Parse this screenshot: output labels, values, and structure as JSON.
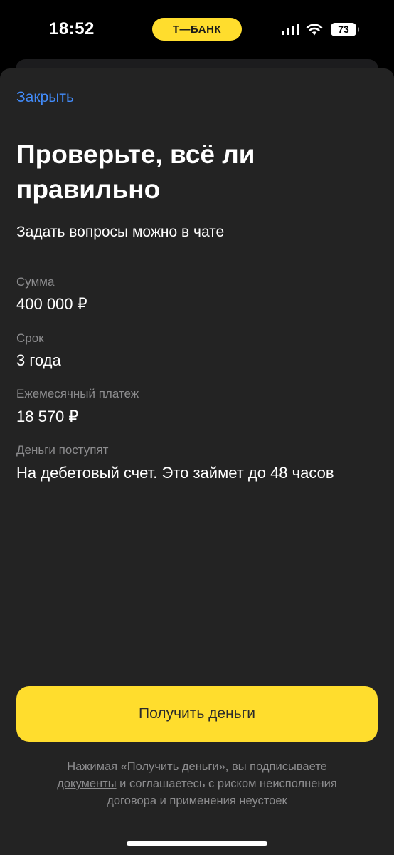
{
  "status_bar": {
    "time": "18:52",
    "bank_label": "Т—БАНК",
    "battery": "73",
    "icons": [
      "signal-icon",
      "wifi-icon",
      "battery-icon"
    ],
    "accent_color": "#ffdd2d"
  },
  "sheet": {
    "close_label": "Закрыть",
    "title_line1": "Проверьте, всё ли",
    "title_line2": "правильно",
    "subtitle": "Задать вопросы можно в чате",
    "fields": [
      {
        "label": "Сумма",
        "value": "400 000 ₽"
      },
      {
        "label": "Срок",
        "value": "3 года"
      },
      {
        "label": "Ежемесячный платеж",
        "value": "18 570 ₽"
      },
      {
        "label": "Деньги поступят",
        "value": "На дебетовый счет. Это займет до 48 часов"
      }
    ],
    "primary_button_label": "Получить деньги",
    "disclaimer": {
      "line1": "Нажимая «Получить деньги», вы подписываете",
      "link_text": "документы",
      "line2_rest": " и соглашаетесь с риском неисполнения",
      "line3": "договора и применения неустоек"
    },
    "colors": {
      "background": "#232323",
      "link": "#428bf9",
      "button": "#ffdd2d",
      "muted_text": "#8c8c8e"
    }
  }
}
